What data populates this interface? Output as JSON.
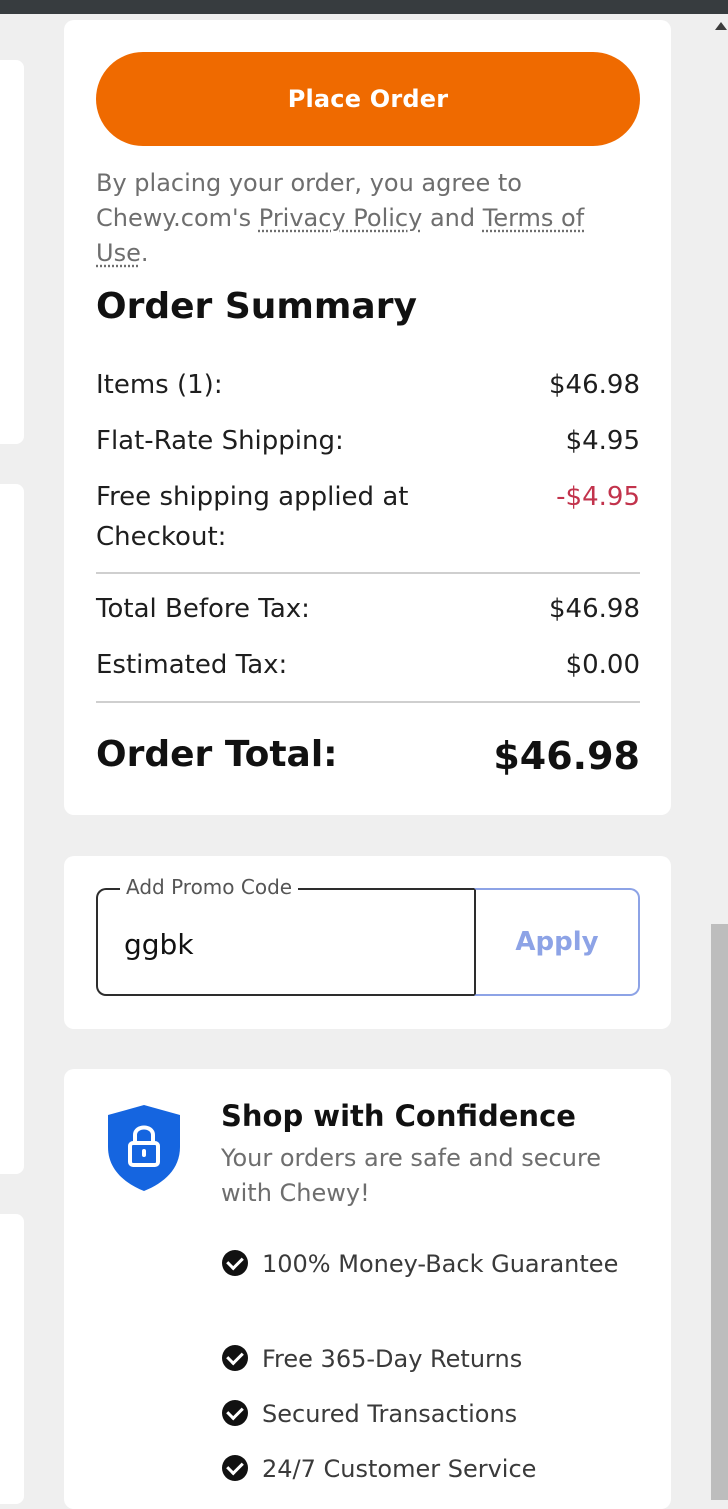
{
  "checkout": {
    "place_order_label": "Place Order",
    "agreement": {
      "prefix": "By placing your order, you agree to Chewy.com's ",
      "privacy_link": "Privacy Policy",
      "middle": " and ",
      "terms_link": "Terms of Use",
      "suffix": "."
    }
  },
  "summary": {
    "title": "Order Summary",
    "items_label": "Items (1):",
    "items_value": "$46.98",
    "shipping_label": "Flat-Rate Shipping:",
    "shipping_value": "$4.95",
    "free_ship_label": "Free shipping applied at Checkout:",
    "free_ship_value": "-$4.95",
    "before_tax_label": "Total Before Tax:",
    "before_tax_value": "$46.98",
    "tax_label": "Estimated Tax:",
    "tax_value": "$0.00",
    "total_label": "Order Total:",
    "total_value": "$46.98"
  },
  "promo": {
    "legend": "Add Promo Code",
    "value": "ggbk",
    "apply_label": "Apply"
  },
  "confidence": {
    "title": "Shop with Confidence",
    "subtitle": "Your orders are safe and secure with Chewy!",
    "items": [
      "100% Money-Back Guarantee",
      "Free 365-Day Returns",
      "Secured Transactions",
      "24/7 Customer Service"
    ]
  },
  "colors": {
    "primary_orange": "#ef6a00",
    "discount_red": "#c2334c",
    "apply_blue": "#8da3e6",
    "shield_blue": "#1565e0"
  },
  "icons": {
    "shield": "shield-lock-icon",
    "check": "check-circle-icon"
  }
}
